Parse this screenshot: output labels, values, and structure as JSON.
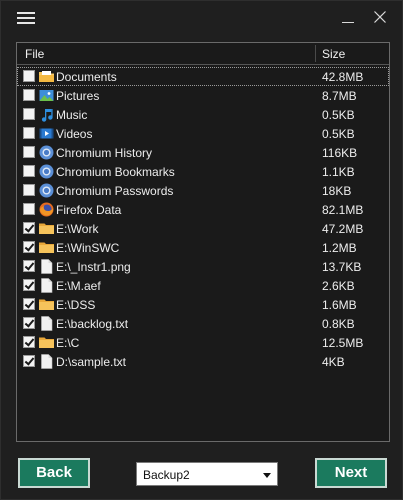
{
  "colors": {
    "background": "#1f1f1f",
    "accent_button": "#1b7a5e",
    "panel_border": "#6a6a6a"
  },
  "titlebar": {
    "menu_icon": "hamburger-menu-icon",
    "minimize_icon": "minimize-icon",
    "close_icon": "close-icon"
  },
  "table": {
    "columns": [
      "File",
      "Size"
    ],
    "rows": [
      {
        "name": "Documents",
        "size": "42.8MB",
        "checked": false,
        "icon": "folder-documents-icon",
        "selected": true
      },
      {
        "name": "Pictures",
        "size": "8.7MB",
        "checked": false,
        "icon": "pictures-icon"
      },
      {
        "name": "Music",
        "size": "0.5KB",
        "checked": false,
        "icon": "music-note-icon"
      },
      {
        "name": "Videos",
        "size": "0.5KB",
        "checked": false,
        "icon": "video-icon"
      },
      {
        "name": "Chromium History",
        "size": "116KB",
        "checked": false,
        "icon": "chromium-icon"
      },
      {
        "name": "Chromium Bookmarks",
        "size": "1.1KB",
        "checked": false,
        "icon": "chromium-icon"
      },
      {
        "name": "Chromium Passwords",
        "size": "18KB",
        "checked": false,
        "icon": "chromium-icon"
      },
      {
        "name": "Firefox Data",
        "size": "82.1MB",
        "checked": false,
        "icon": "firefox-icon"
      },
      {
        "name": "E:\\Work",
        "size": "47.2MB",
        "checked": true,
        "icon": "folder-icon"
      },
      {
        "name": "E:\\WinSWC",
        "size": "1.2MB",
        "checked": true,
        "icon": "folder-icon"
      },
      {
        "name": "E:\\_Instr1.png",
        "size": "13.7KB",
        "checked": true,
        "icon": "file-icon"
      },
      {
        "name": "E:\\M.aef",
        "size": "2.6KB",
        "checked": true,
        "icon": "file-icon"
      },
      {
        "name": "E:\\DSS",
        "size": "1.6MB",
        "checked": true,
        "icon": "folder-icon"
      },
      {
        "name": "E:\\backlog.txt",
        "size": "0.8KB",
        "checked": true,
        "icon": "file-icon"
      },
      {
        "name": "E:\\C",
        "size": "12.5MB",
        "checked": true,
        "icon": "folder-icon"
      },
      {
        "name": "D:\\sample.txt",
        "size": "4KB",
        "checked": true,
        "icon": "file-icon"
      }
    ]
  },
  "footer": {
    "back_label": "Back",
    "next_label": "Next",
    "backup_select_value": "Backup2"
  }
}
